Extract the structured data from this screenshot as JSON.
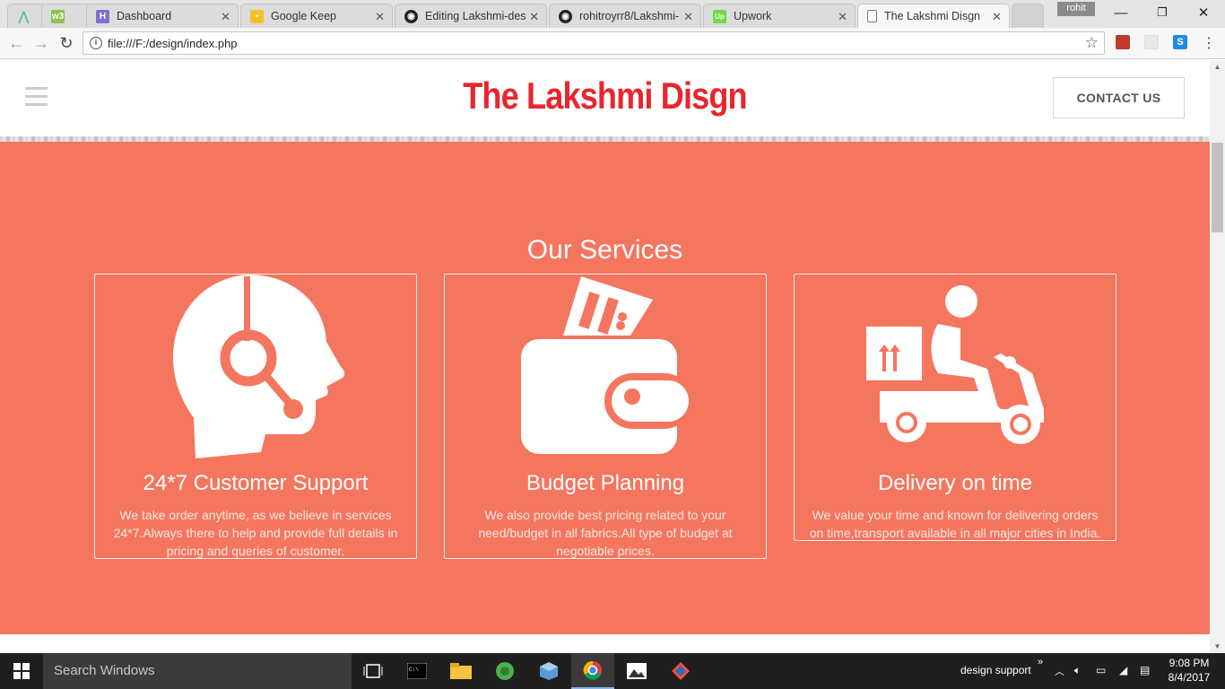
{
  "browser": {
    "tabs": [
      {
        "title": "",
        "favicon": "arrow-logo-icon"
      },
      {
        "title": "",
        "favicon": "w3schools-icon"
      },
      {
        "title": "Dashboard",
        "favicon": "hubspot-icon"
      },
      {
        "title": "Google Keep",
        "favicon": "keep-icon"
      },
      {
        "title": "Editing Lakshmi-desi",
        "favicon": "github-icon"
      },
      {
        "title": "rohitroyrr8/Lakshmi-",
        "favicon": "github-icon"
      },
      {
        "title": "Upwork",
        "favicon": "upwork-icon"
      },
      {
        "title": "The Lakshmi Disgn",
        "favicon": "page-icon"
      }
    ],
    "favicon_text": {
      "w3": "w3",
      "upwork": "Up"
    },
    "profile_name": "rohit",
    "url": "file:///F:/design/index.php",
    "window_controls": {
      "minimize": "—",
      "restore": "❐",
      "close": "✕"
    }
  },
  "site": {
    "logo": "The Lakshmi Disgn",
    "contact_button": "CONTACT US",
    "services_heading": "Our Services",
    "services": [
      {
        "title": "24*7 Customer Support",
        "text": "We take order anytime, as we believe in services 24*7.Always there to help and provide full details in pricing and queries of customer.",
        "icon": "headset-support-icon"
      },
      {
        "title": "Budget Planning",
        "text": "We also provide best pricing related to your need/budget in all fabrics.All type of budget at negotiable prices.",
        "icon": "wallet-icon"
      },
      {
        "title": "Delivery on time",
        "text": "We value your time and known for delivering orders on time,transport available in all major cities in India.",
        "icon": "delivery-scooter-icon"
      }
    ],
    "colors": {
      "accent": "#f4765e",
      "logo": "#e8262e"
    }
  },
  "taskbar": {
    "search_placeholder": "Search Windows",
    "tray_label": "design support",
    "time": "9:08 PM",
    "date": "8/4/2017"
  }
}
